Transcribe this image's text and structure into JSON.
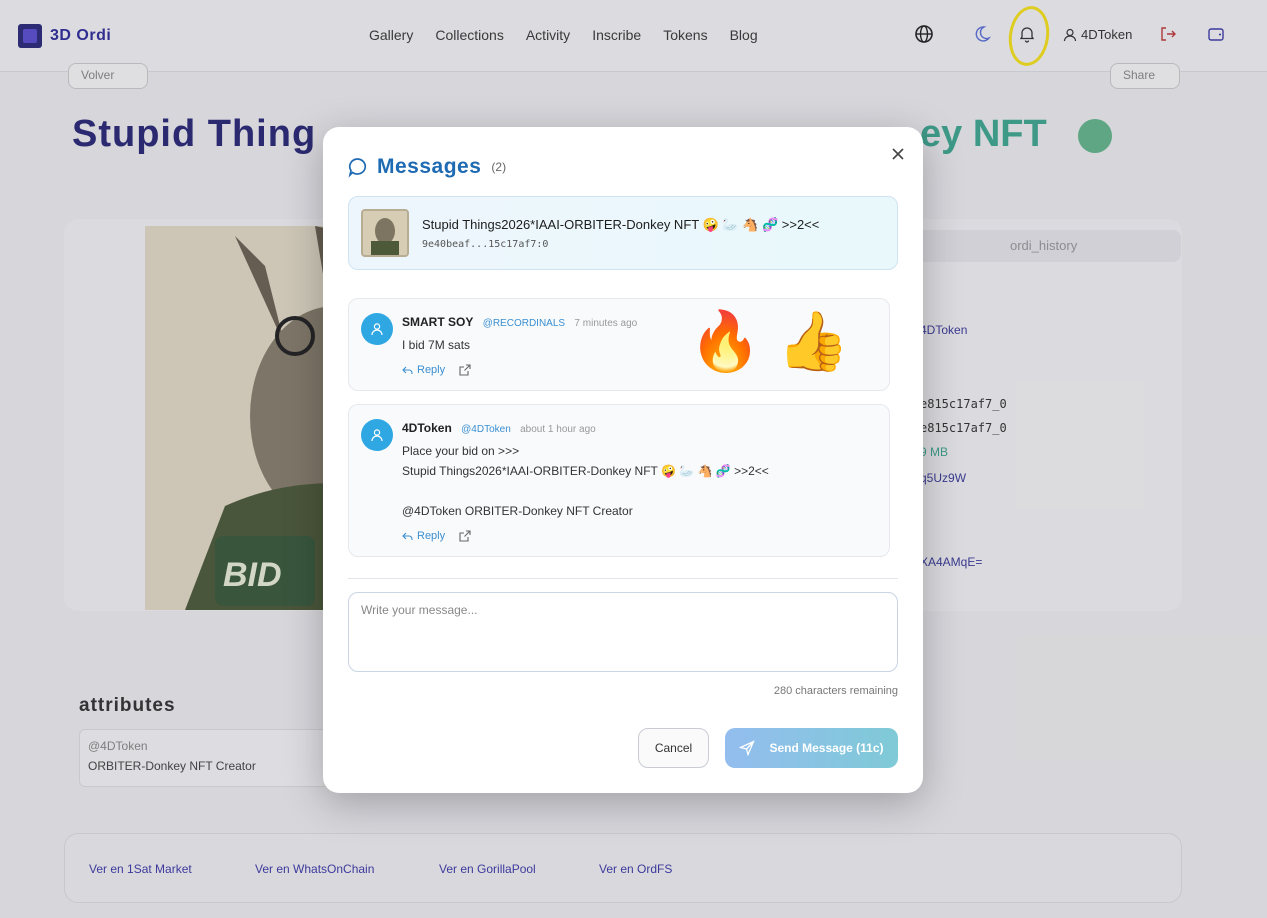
{
  "topnav": {
    "logo_text": "3D Ordi",
    "links": [
      "Gallery",
      "Collections",
      "Activity",
      "Inscribe",
      "Tokens",
      "Blog"
    ],
    "user_label": "4DToken"
  },
  "background": {
    "back_label": "Volver",
    "share_label": "Share",
    "title_left": "Stupid Thing",
    "title_right": "ey NFT",
    "tab_label": "ordi_history",
    "right_lines": [
      "4DToken",
      "e815c17af7_0",
      "e815c17af7_0",
      "9 MB",
      "q5Uz9W",
      "XA4AMqE="
    ],
    "attributes_title": "attributes",
    "attr_key": "@4DToken",
    "attr_value": "ORBITER-Donkey NFT Creator",
    "bid_plate_text": "BID",
    "links": [
      "Ver en 1Sat Market",
      "Ver en WhatsOnChain",
      "Ver en GorillaPool",
      "Ver en OrdFS"
    ]
  },
  "modal": {
    "title": "Messages",
    "count": "(2)",
    "nft": {
      "name": "Stupid Things2026*IAAI-ORBITER-Donkey NFT 🤪 🦢 🐴 🧬 >>2<<",
      "id": "9e40beaf...15c17af7:0"
    },
    "messages": [
      {
        "author": "SMART SOY",
        "handle": "@RECORDINALS",
        "time": "7 minutes ago",
        "lines": [
          "I bid 7M sats"
        ],
        "reply_label": "Reply",
        "emojis": [
          "🔥",
          "👍"
        ]
      },
      {
        "author": "4DToken",
        "handle": "@4DToken",
        "time": "about 1 hour ago",
        "lines": [
          "Place your bid on >>>",
          "Stupid Things2026*IAAI-ORBITER-Donkey NFT 🤪 🦢 🐴 🧬 >>2<<",
          "",
          "@4DToken ORBITER-Donkey NFT Creator"
        ],
        "reply_label": "Reply"
      }
    ],
    "input_placeholder": "Write your message...",
    "chars_remaining": "280 characters remaining",
    "cancel_label": "Cancel",
    "send_label": "Send Message (11c)"
  },
  "colors": {
    "accent": "#1e6ab3",
    "avatar": "#2ea7e3",
    "highlight": "#f5e21b"
  }
}
